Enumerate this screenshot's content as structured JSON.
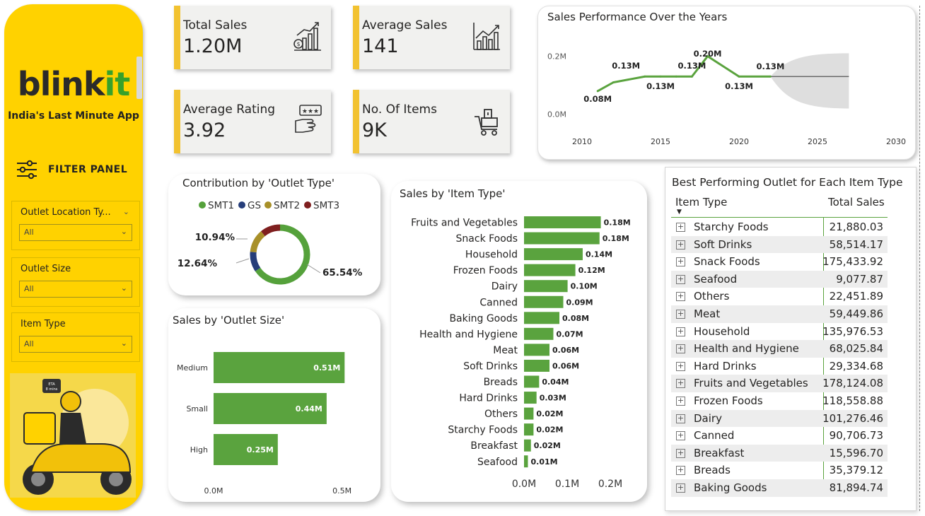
{
  "brand": {
    "logo_main": "blink",
    "logo_accent": "it",
    "tagline": "India's Last Minute App",
    "accent_yellow": "#FFD200",
    "accent_green": "#38A12A",
    "bar_green": "#5AA33E"
  },
  "filter_panel": {
    "label": "FILTER PANEL",
    "slicers": [
      {
        "title": "Outlet Location Ty...",
        "value": "All"
      },
      {
        "title": "Outlet Size",
        "value": "All"
      },
      {
        "title": "Item Type",
        "value": "All"
      }
    ]
  },
  "kpis": [
    {
      "label": "Total Sales",
      "value": "1.20M",
      "icon": "money-growth-icon"
    },
    {
      "label": "Average Sales",
      "value": "141",
      "icon": "bar-growth-icon"
    },
    {
      "label": "Average Rating",
      "value": "3.92",
      "icon": "rating-hand-icon"
    },
    {
      "label": "No. Of Items",
      "value": "9K",
      "icon": "cart-items-icon"
    }
  ],
  "sales_over_years": {
    "title": "Sales Performance Over the Years",
    "chart_data": {
      "type": "line",
      "title": "Sales Performance Over the Years",
      "x": [
        2011,
        2012,
        2014,
        2015,
        2016,
        2017,
        2018,
        2020,
        2022
      ],
      "values": [
        0.08,
        0.11,
        0.13,
        0.13,
        0.13,
        0.13,
        0.2,
        0.13,
        0.13
      ],
      "data_labels": [
        {
          "x": 2011,
          "text": "0.08M"
        },
        {
          "x": 2012.8,
          "text": "0.13M"
        },
        {
          "x": 2015,
          "text": "0.13M"
        },
        {
          "x": 2017,
          "text": "0.13M"
        },
        {
          "x": 2018,
          "text": "0.20M"
        },
        {
          "x": 2020,
          "text": "0.13M"
        },
        {
          "x": 2022,
          "text": "0.13M"
        }
      ],
      "forecast": {
        "from": 2022,
        "to": 2027,
        "value": 0.13,
        "upper": 0.21,
        "lower": 0.02
      },
      "xlim": [
        2010,
        2030
      ],
      "ylim": [
        -0.03,
        0.25
      ],
      "x_ticks": [
        "2010",
        "2015",
        "2020",
        "2025",
        "2030"
      ],
      "y_ticks": [
        {
          "v": 0.2,
          "label": "0.2M"
        },
        {
          "v": 0.0,
          "label": "0.0M"
        }
      ]
    }
  },
  "outlet_type": {
    "title": "Contribution by 'Outlet Type'",
    "chart_data": {
      "type": "pie",
      "title": "Contribution by 'Outlet Type'",
      "series": [
        {
          "name": "SMT1",
          "value": 65.54,
          "color": "#55A13B"
        },
        {
          "name": "GS",
          "value": 10.88,
          "color": "#263E7A"
        },
        {
          "name": "SMT2",
          "value": 12.64,
          "color": "#A89029"
        },
        {
          "name": "SMT3",
          "value": 10.94,
          "color": "#7F1F1F"
        }
      ],
      "labels": [
        "10.94%",
        "12.64%",
        "65.54%"
      ]
    }
  },
  "outlet_size": {
    "title": "Sales by 'Outlet Size'",
    "chart_data": {
      "type": "bar",
      "title": "Sales by 'Outlet Size'",
      "categories": [
        "Medium",
        "Small",
        "High"
      ],
      "values": [
        0.51,
        0.44,
        0.25
      ],
      "value_labels": [
        "0.51M",
        "0.44M",
        "0.25M"
      ],
      "xlim": [
        0,
        0.6
      ],
      "x_ticks": [
        {
          "v": 0,
          "label": "0.0M"
        },
        {
          "v": 0.5,
          "label": "0.5M"
        }
      ]
    }
  },
  "item_type": {
    "title": "Sales by 'Item Type'",
    "chart_data": {
      "type": "bar",
      "title": "Sales by 'Item Type'",
      "categories": [
        "Fruits and Vegetables",
        "Snack Foods",
        "Household",
        "Frozen Foods",
        "Dairy",
        "Canned",
        "Baking Goods",
        "Health and Hygiene",
        "Meat",
        "Soft Drinks",
        "Breads",
        "Hard Drinks",
        "Others",
        "Starchy Foods",
        "Breakfast",
        "Seafood"
      ],
      "values": [
        0.178,
        0.175,
        0.136,
        0.119,
        0.101,
        0.091,
        0.082,
        0.068,
        0.059,
        0.059,
        0.035,
        0.029,
        0.022,
        0.022,
        0.016,
        0.009
      ],
      "value_labels": [
        "0.18M",
        "0.18M",
        "0.14M",
        "0.12M",
        "0.10M",
        "0.09M",
        "0.08M",
        "0.07M",
        "0.06M",
        "0.06M",
        "0.04M",
        "0.03M",
        "0.02M",
        "0.02M",
        "0.02M",
        "0.01M"
      ],
      "xlim": [
        0,
        0.2
      ],
      "x_ticks": [
        {
          "v": 0,
          "label": "0.0M"
        },
        {
          "v": 0.1,
          "label": "0.1M"
        },
        {
          "v": 0.2,
          "label": "0.2M"
        }
      ]
    }
  },
  "best_outlet": {
    "title": "Best Performing Outlet for Each Item Type",
    "columns": [
      "Item Type",
      "Total Sales"
    ],
    "expand_glyph": "+",
    "rows": [
      {
        "name": "Starchy Foods",
        "value": "21,880.03"
      },
      {
        "name": "Soft Drinks",
        "value": "58,514.17"
      },
      {
        "name": "Snack Foods",
        "value": "175,433.92"
      },
      {
        "name": "Seafood",
        "value": "9,077.87"
      },
      {
        "name": "Others",
        "value": "22,451.89"
      },
      {
        "name": "Meat",
        "value": "59,449.86"
      },
      {
        "name": "Household",
        "value": "135,976.53"
      },
      {
        "name": "Health and Hygiene",
        "value": "68,025.84"
      },
      {
        "name": "Hard Drinks",
        "value": "29,334.68"
      },
      {
        "name": "Fruits and Vegetables",
        "value": "178,124.08"
      },
      {
        "name": "Frozen Foods",
        "value": "118,558.88"
      },
      {
        "name": "Dairy",
        "value": "101,276.46"
      },
      {
        "name": "Canned",
        "value": "90,706.73"
      },
      {
        "name": "Breakfast",
        "value": "15,596.70"
      },
      {
        "name": "Breads",
        "value": "35,379.12"
      },
      {
        "name": "Baking Goods",
        "value": "81,894.74"
      }
    ]
  }
}
